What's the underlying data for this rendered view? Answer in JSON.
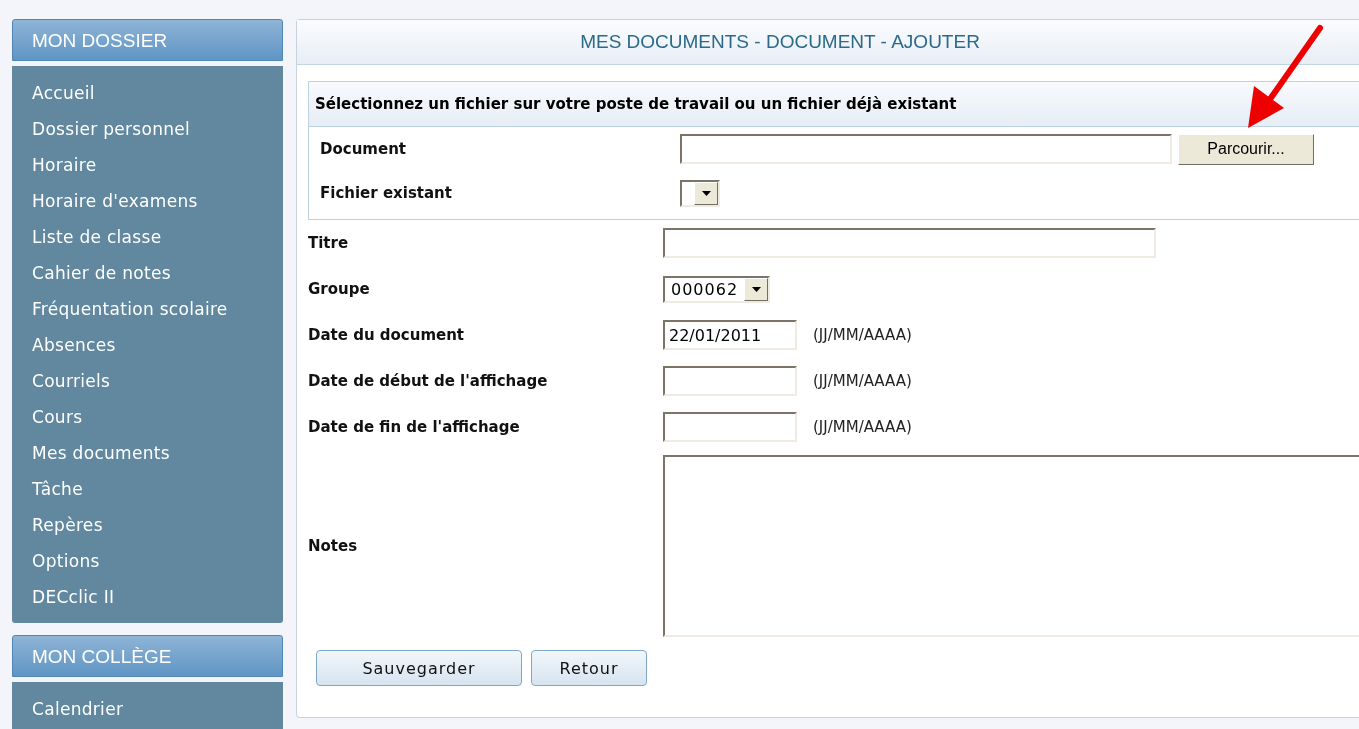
{
  "sidebar": [
    {
      "title": "MON DOSSIER",
      "items": [
        "Accueil",
        "Dossier personnel",
        "Horaire",
        "Horaire d'examens",
        "Liste de classe",
        "Cahier de notes",
        "Fréquentation scolaire",
        "Absences",
        "Courriels",
        "Cours",
        "Mes documents",
        "Tâche",
        "Repères",
        "Options",
        "DECclic II"
      ]
    },
    {
      "title": "MON COLLÈGE",
      "items": [
        "Calendrier"
      ]
    }
  ],
  "main": {
    "title": "MES DOCUMENTS - DOCUMENT - AJOUTER",
    "file_section": {
      "heading": "Sélectionnez un fichier sur votre poste de travail ou un fichier déjà existant",
      "fields": [
        {
          "kind": "file",
          "label": "Document",
          "button": "Parcourir..."
        },
        {
          "kind": "select",
          "label": "Fichier existant"
        }
      ]
    },
    "fields": [
      {
        "kind": "text",
        "label": "Titre"
      },
      {
        "kind": "select",
        "label": "Groupe",
        "value": "000062"
      },
      {
        "kind": "date",
        "label": "Date du document",
        "value": "22/01/2011",
        "hint": "(JJ/MM/AAAA)"
      },
      {
        "kind": "date",
        "label": "Date de début de l'affichage",
        "hint": "(JJ/MM/AAAA)"
      },
      {
        "kind": "date",
        "label": "Date de fin de l'affichage",
        "hint": "(JJ/MM/AAAA)"
      },
      {
        "kind": "textarea",
        "label": "Notes"
      }
    ],
    "buttons": [
      "Sauvegarder",
      "Retour"
    ]
  }
}
